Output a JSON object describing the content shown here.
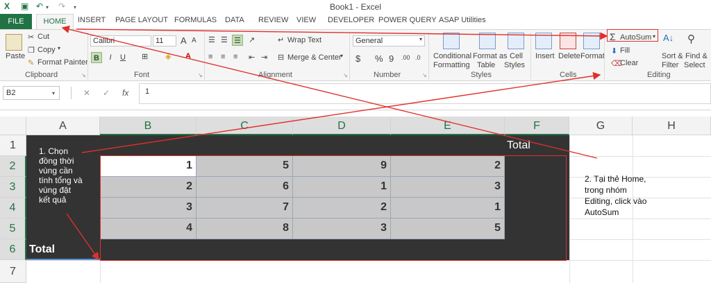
{
  "window": {
    "title": "Book1 - Excel"
  },
  "tabs": [
    "FILE",
    "HOME",
    "INSERT",
    "PAGE LAYOUT",
    "FORMULAS",
    "DATA",
    "REVIEW",
    "VIEW",
    "DEVELOPER",
    "POWER QUERY",
    "ASAP Utilities"
  ],
  "clipboard": {
    "paste": "Paste",
    "cut": "Cut",
    "copy": "Copy",
    "format_painter": "Format Painter",
    "label": "Clipboard"
  },
  "font": {
    "name": "Calibri",
    "size": "11",
    "bold": "B",
    "italic": "I",
    "underline": "U",
    "grow": "A",
    "shrink": "A",
    "label": "Font"
  },
  "alignment": {
    "wrap_text": "Wrap Text",
    "merge_center": "Merge & Center",
    "label": "Alignment"
  },
  "number": {
    "format": "General",
    "currency": "$",
    "percent": "%",
    "comma": "9",
    "inc_dec": ".00",
    "dec_dec": ".0",
    "label": "Number"
  },
  "styles": {
    "conditional1": "Conditional",
    "conditional2": "Formatting",
    "format_as1": "Format as",
    "format_as2": "Table",
    "cell1": "Cell",
    "cell2": "Styles",
    "label": "Styles"
  },
  "cells": {
    "insert": "Insert",
    "delete": "Delete",
    "format": "Format",
    "label": "Cells"
  },
  "editing": {
    "autosum": "AutoSum",
    "fill": "Fill",
    "clear": "Clear",
    "sort1": "Sort &",
    "sort2": "Filter",
    "find1": "Find &",
    "find2": "Select",
    "label": "Editing"
  },
  "formula_bar": {
    "name_box": "B2",
    "fx": "fx",
    "value": "1"
  },
  "grid": {
    "columns": [
      "A",
      "B",
      "C",
      "D",
      "E",
      "F",
      "G",
      "H"
    ],
    "rows": [
      "1",
      "2",
      "3",
      "4",
      "5",
      "6",
      "7"
    ],
    "header_total": "Total",
    "row_total": "Total",
    "values": [
      [
        "1",
        "5",
        "9",
        "2"
      ],
      [
        "2",
        "6",
        "1",
        "3"
      ],
      [
        "3",
        "7",
        "2",
        "1"
      ],
      [
        "4",
        "8",
        "3",
        "5"
      ]
    ]
  },
  "annotations": {
    "step1": [
      "1. Chọn",
      "đồng thời",
      "vùng cần",
      "tính tổng và",
      "vùng đặt",
      "kết quả"
    ],
    "step2": [
      "2. Tại thẻ Home,",
      "trong nhóm",
      "Editing, click vào",
      "AutoSum"
    ]
  },
  "colors": {
    "accent": "#217346",
    "annotation": "#e0302b",
    "dark_fill": "#333333"
  }
}
